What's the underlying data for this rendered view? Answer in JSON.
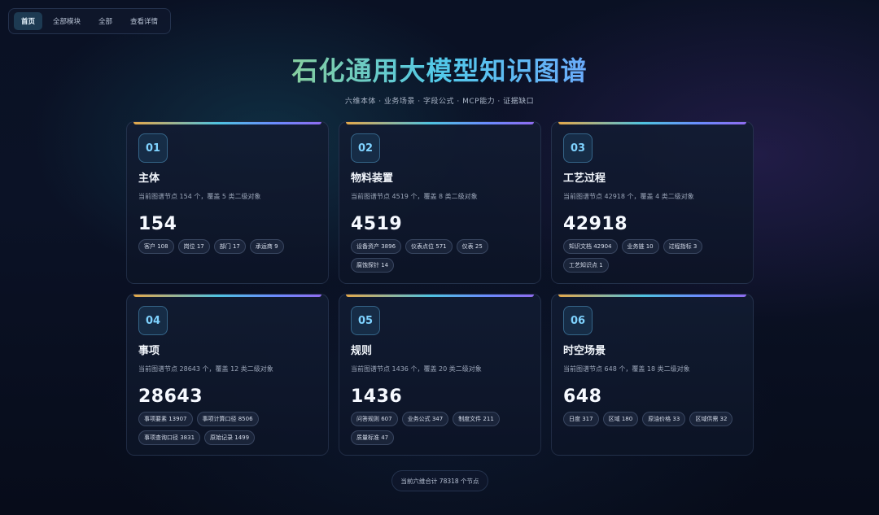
{
  "nav": {
    "items": [
      {
        "label": "首页",
        "active": true
      },
      {
        "label": "全部模块",
        "active": false
      },
      {
        "label": "全部",
        "active": false
      },
      {
        "label": "查看详情",
        "active": false
      }
    ]
  },
  "header": {
    "title": "石化通用大模型知识图谱",
    "subtitle": "六维本体 · 业务场景 · 字段公式 · MCP能力 · 证据缺口"
  },
  "cards": [
    {
      "index": "01",
      "title": "主体",
      "desc": "当前图谱节点 154 个，覆盖 5 类二级对象",
      "count": "154",
      "chips": [
        "客户 108",
        "岗位 17",
        "部门 17",
        "承运商 9"
      ]
    },
    {
      "index": "02",
      "title": "物料装置",
      "desc": "当前图谱节点 4519 个，覆盖 8 类二级对象",
      "count": "4519",
      "chips": [
        "设备资产 3896",
        "仪表点位 571",
        "仪表 25",
        "腐蚀探针 14"
      ]
    },
    {
      "index": "03",
      "title": "工艺过程",
      "desc": "当前图谱节点 42918 个，覆盖 4 类二级对象",
      "count": "42918",
      "chips": [
        "知识文档 42904",
        "业务链 10",
        "过程指标 3",
        "工艺知识点 1"
      ]
    },
    {
      "index": "04",
      "title": "事项",
      "desc": "当前图谱节点 28643 个，覆盖 12 类二级对象",
      "count": "28643",
      "chips": [
        "事项要素 13907",
        "事项计算口径 8506",
        "事项查询口径 3831",
        "原始记录 1499"
      ]
    },
    {
      "index": "05",
      "title": "规则",
      "desc": "当前图谱节点 1436 个，覆盖 20 类二级对象",
      "count": "1436",
      "chips": [
        "问答规则 607",
        "业务公式 347",
        "制度文件 211",
        "质量标准 47"
      ]
    },
    {
      "index": "06",
      "title": "时空场景",
      "desc": "当前图谱节点 648 个，覆盖 18 类二级对象",
      "count": "648",
      "chips": [
        "日度 317",
        "区域 180",
        "原油价格 33",
        "区域供需 32"
      ]
    }
  ],
  "footer": {
    "summary": "当前六维合计 78318 个节点"
  }
}
